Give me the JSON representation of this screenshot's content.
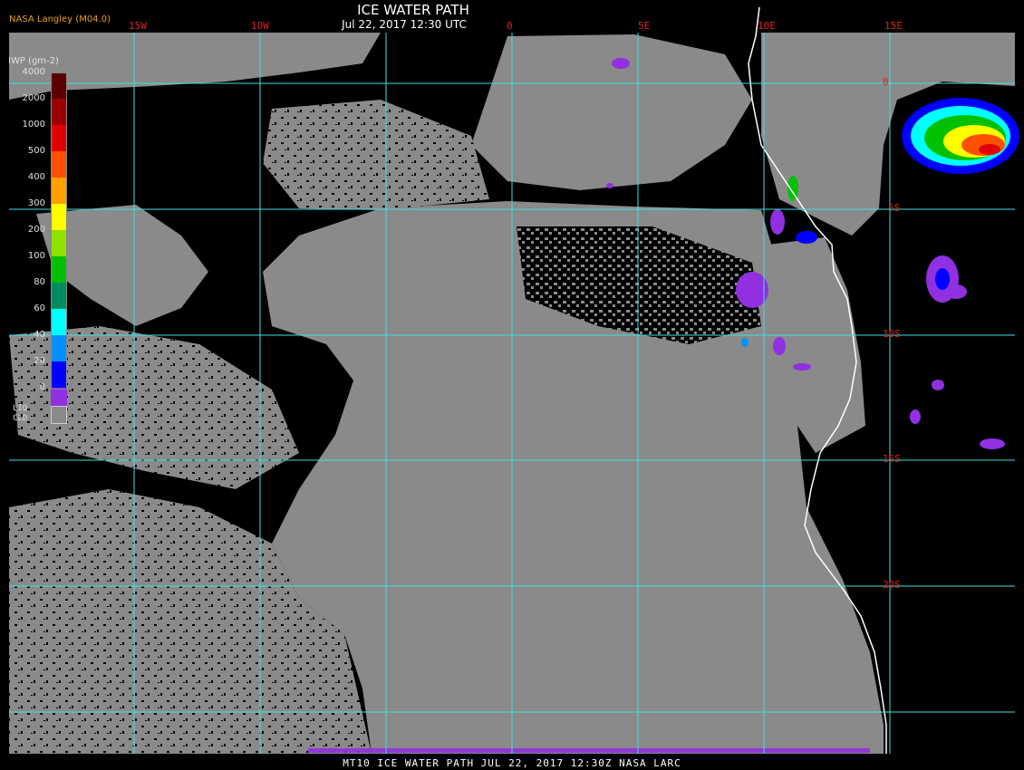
{
  "header": {
    "title": "ICE WATER PATH",
    "subtitle": "Jul 22, 2017 12:30 UTC",
    "brand": "NASA Langley (M04.0)"
  },
  "legend": {
    "title": "IWP (gm-2)",
    "ticks": [
      "4000",
      "2000",
      "1000",
      "500",
      "400",
      "300",
      "200",
      "100",
      "80",
      "60",
      "40",
      "20",
      "0"
    ],
    "colors": [
      "#5a0000",
      "#9a0000",
      "#e00000",
      "#ff5000",
      "#ffa000",
      "#ffff00",
      "#90e000",
      "#00c000",
      "#008c60",
      "#00ffff",
      "#0090ff",
      "#0000ff",
      "#9030e0"
    ],
    "liquid_label": "LIQ\nCLD",
    "liquid_color": "#8a8a8a"
  },
  "grid": {
    "longitudes": [
      "15W",
      "10W",
      "0",
      "5E",
      "10E",
      "15E"
    ],
    "latitudes": [
      "0",
      "5S",
      "10S",
      "15S",
      "20S"
    ],
    "line_color": "#40e0e0"
  },
  "colors": {
    "ocean": "#000000",
    "liquid_cloud": "#8a8a8a",
    "coastline": "#ffffff"
  },
  "footer": "MT10  ICE WATER PATH  JUL 22, 2017 12:30Z  NASA LARC"
}
